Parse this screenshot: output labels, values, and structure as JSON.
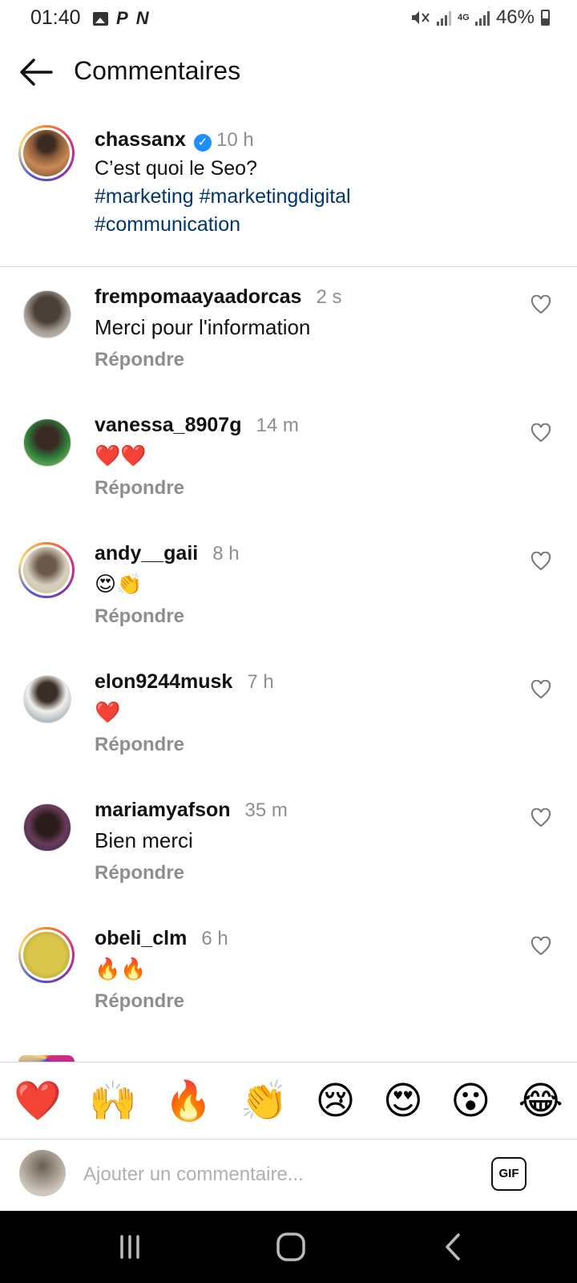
{
  "status_bar": {
    "time": "01:40",
    "left_icons": [
      "image-icon",
      "p-icon",
      "n-icon"
    ],
    "right_icons": [
      "mute-vibrate-icon",
      "signal-icon",
      "4g-signal-icon"
    ],
    "network": "4G",
    "battery": "46%"
  },
  "header": {
    "back_icon": "arrow-left-icon",
    "title": "Commentaires"
  },
  "caption": {
    "username": "chassanx",
    "verified": true,
    "time": "10 h",
    "text": "C’est quoi le Seo?",
    "hashtags": [
      "#marketing",
      "#marketingdigital",
      "#communication"
    ]
  },
  "comments": [
    {
      "username": "frempomaayaadorcas",
      "time": "2 s",
      "text": "Merci pour l'information",
      "reply": "Répondre",
      "story_ring": false
    },
    {
      "username": "vanessa_8907g",
      "time": "14 m",
      "text": "❤️❤️",
      "reply": "Répondre",
      "story_ring": false
    },
    {
      "username": "andy__gaii",
      "time": "8 h",
      "text": "😍👏",
      "reply": "Répondre",
      "story_ring": true
    },
    {
      "username": "elon9244musk",
      "time": "7 h",
      "text": "❤️",
      "reply": "Répondre",
      "story_ring": false
    },
    {
      "username": "mariamyafson",
      "time": "35 m",
      "text": "Bien merci",
      "reply": "Répondre",
      "story_ring": false
    },
    {
      "username": "obeli_clm",
      "time": "6 h",
      "text": "🔥🔥",
      "reply": "Répondre",
      "story_ring": true
    }
  ],
  "emoji_bar": [
    "❤️",
    "🙌",
    "🔥",
    "👏",
    "😢",
    "😍",
    "😮",
    "😂"
  ],
  "input": {
    "placeholder": "Ajouter un commentaire...",
    "gif_label": "GIF"
  },
  "nav_bar": [
    "recents-icon",
    "home-icon",
    "back-icon"
  ],
  "colors": {
    "hashtag": "#00376b",
    "verified": "#1f8fff",
    "muted_text": "#8e8e8e",
    "divider": "#dbdbdb"
  }
}
